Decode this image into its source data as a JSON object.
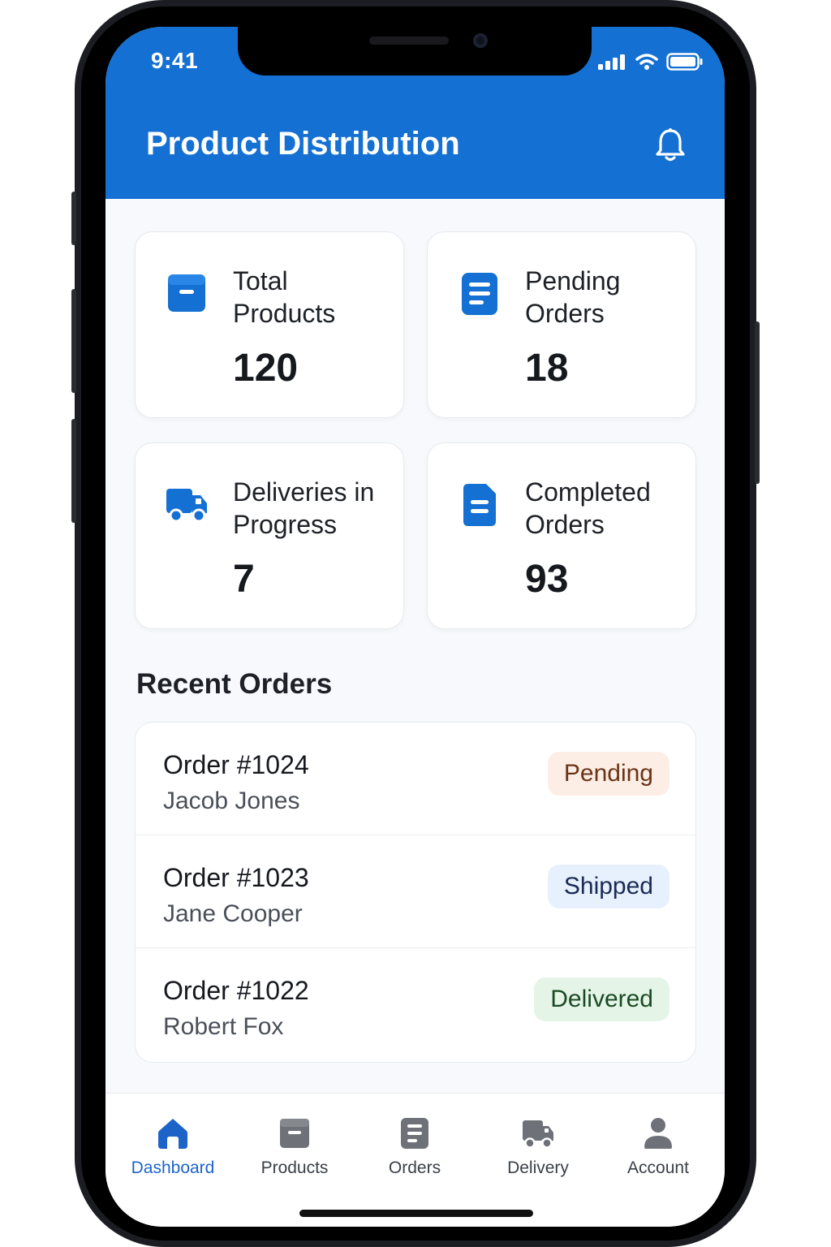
{
  "status_bar": {
    "time": "9:41"
  },
  "header": {
    "title": "Product Distribution",
    "notification_icon": "bell-icon"
  },
  "stats": [
    {
      "label": "Total Products",
      "value": "120",
      "icon": "archive-box-icon"
    },
    {
      "label": "Pending Orders",
      "value": "18",
      "icon": "document-list-icon"
    },
    {
      "label": "Deliveries in Progress",
      "value": "7",
      "icon": "truck-icon"
    },
    {
      "label": "Completed Orders",
      "value": "93",
      "icon": "document-icon"
    }
  ],
  "recent_orders": {
    "title": "Recent Orders",
    "items": [
      {
        "order": "Order #1024",
        "customer": "Jacob Jones",
        "status": "Pending",
        "status_color": "#6b3418",
        "status_bg": "#fdeee5"
      },
      {
        "order": "Order #1023",
        "customer": "Jane Cooper",
        "status": "Shipped",
        "status_color": "#1a2a55",
        "status_bg": "#e6f1fd"
      },
      {
        "order": "Order #1022",
        "customer": "Robert Fox",
        "status": "Delivered",
        "status_color": "#1c4a24",
        "status_bg": "#e4f5e8"
      }
    ]
  },
  "tabs": [
    {
      "label": "Dashboard",
      "icon": "home-icon",
      "active": true
    },
    {
      "label": "Products",
      "icon": "archive-box-icon",
      "active": false
    },
    {
      "label": "Orders",
      "icon": "document-list-icon",
      "active": false
    },
    {
      "label": "Delivery",
      "icon": "truck-icon",
      "active": false
    },
    {
      "label": "Account",
      "icon": "person-icon",
      "active": false
    }
  ],
  "colors": {
    "brand": "#1470d2",
    "active_tab": "#1d64c8",
    "inactive_icon": "#6e7177"
  }
}
